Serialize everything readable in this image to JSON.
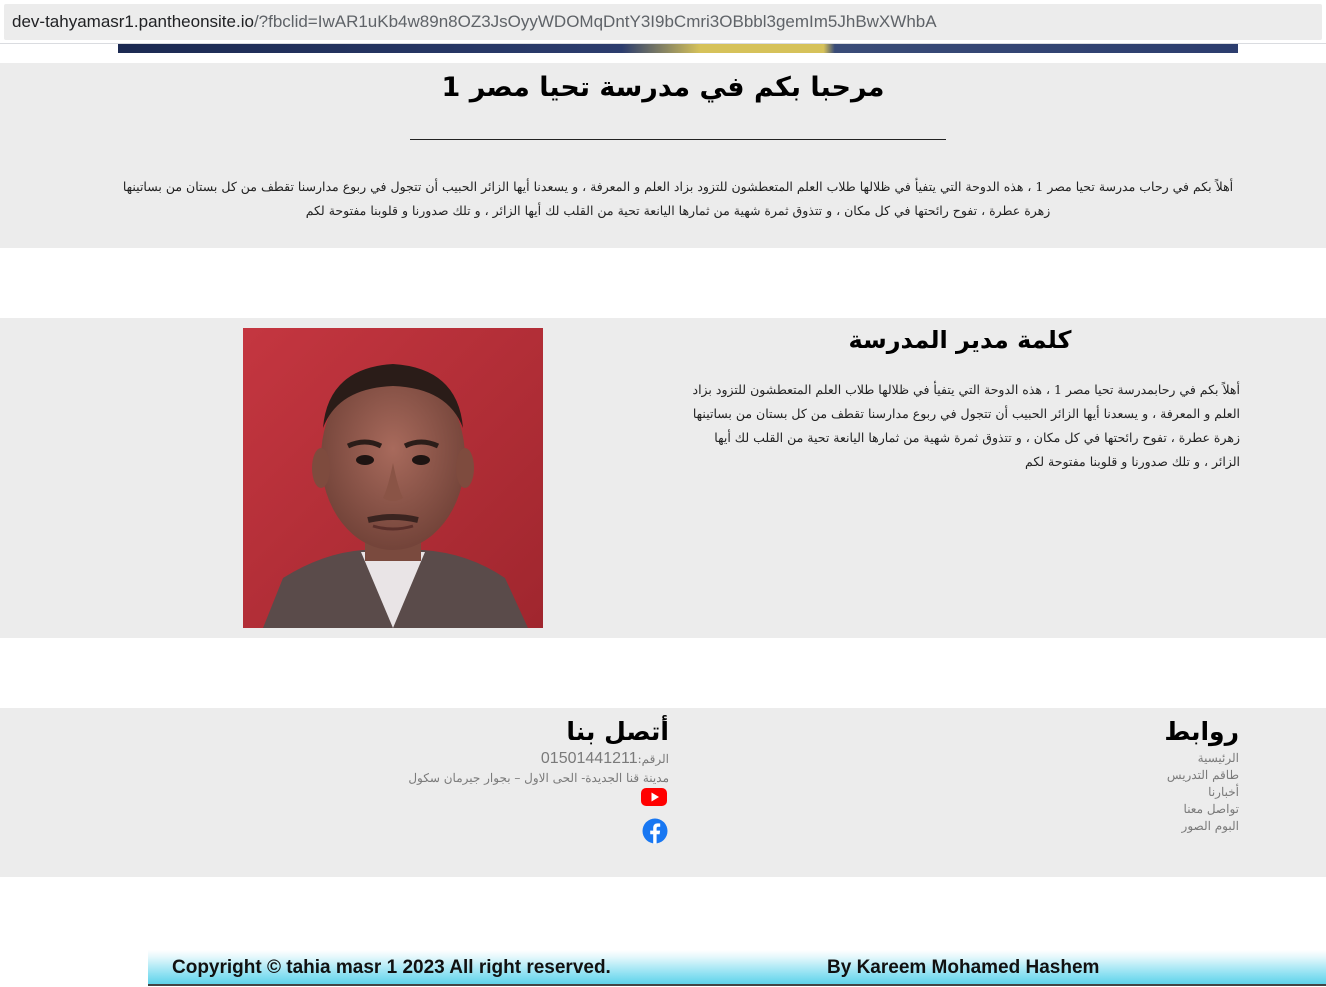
{
  "browser": {
    "url_host": "dev-tahyamasr1.pantheonsite.io",
    "url_rest": "/?fbclid=IwAR1uKb4w89n8OZ3JsOyyWDOMqDntY3I9bCmri3OBbbl3gemIm5JhBwXWhbA"
  },
  "welcome": {
    "title": "مرحبا بكم في مدرسة تحيا مصر 1",
    "text": "أهلاً بكم في رحاب مدرسة تحيا مصر 1 ، هذه الدوحة التي يتفيأ في ظلالها طلاب العلم المتعطشون للتزود بزاد العلم و المعرفة ، و يسعدنا أيها الزائر الحبيب أن تتجول في ربوع مدارسنا تقطف من كل بستان من بساتينها زهرة عطرة ، تفوح رائحتها في كل مكان ، و تتذوق ثمرة شهية من ثمارها اليانعة تحية من القلب لك أيها الزائر ، و تلك صدورنا و قلوبنا مفتوحة لكم"
  },
  "principal": {
    "title": "كلمة مدير المدرسة",
    "text": "أهلاً بكم في رحابمدرسة تحيا مصر 1 ، هذه الدوحة التي يتفيأ في ظلالها طلاب العلم المتعطشون للتزود بزاد العلم و المعرفة ، و يسعدنا أيها الزائر الحبيب أن تتجول في ربوع مدارسنا تقطف من كل بستان من بساتينها زهرة عطرة ، تفوح رائحتها في كل مكان ، و تتذوق ثمرة شهية من ثمارها اليانعة تحية من القلب لك أيها الزائر ، و تلك صدورنا و قلوبنا مفتوحة لكم"
  },
  "footer": {
    "links_title": "روابط",
    "links": [
      "الرئيسية",
      "طاقم التدريس",
      "أخبارنا",
      "تواصل معنا",
      "البوم الصور"
    ],
    "contact_title": "أتصل بنا",
    "phone_label": "الرقم:",
    "phone": "01501441211",
    "address": "مدينة قنا الجديدة- الحى الاول – بجوار جيرمان سكول",
    "colors": {
      "youtube": "#ff0000",
      "facebook": "#1877f2"
    }
  },
  "copyright": {
    "left": "Copyright © tahia masr 1 2023 All right reserved.",
    "right": "By Kareem Mohamed Hashem"
  }
}
